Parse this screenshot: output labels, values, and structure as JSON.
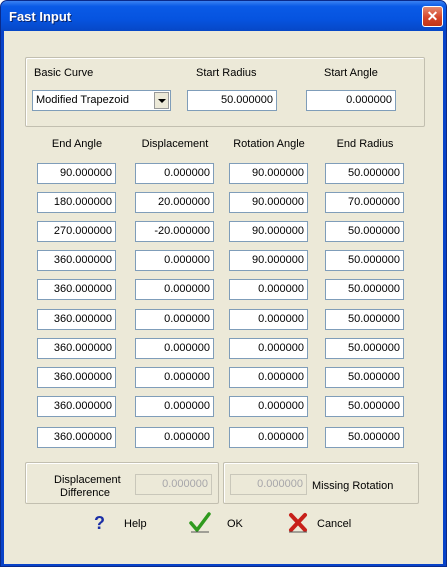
{
  "window": {
    "title": "Fast Input",
    "close_symbol": "✕"
  },
  "basic": {
    "basic_curve_label": "Basic Curve",
    "basic_curve_value": "Modified Trapezoid",
    "start_radius_label": "Start Radius",
    "start_radius_value": "50.000000",
    "start_angle_label": "Start Angle",
    "start_angle_value": "0.000000"
  },
  "table": {
    "headers": [
      "End Angle",
      "Displacement",
      "Rotation Angle",
      "End Radius"
    ],
    "rows": [
      [
        "90.000000",
        "0.000000",
        "90.000000",
        "50.000000"
      ],
      [
        "180.000000",
        "20.000000",
        "90.000000",
        "70.000000"
      ],
      [
        "270.000000",
        "-20.000000",
        "90.000000",
        "50.000000"
      ],
      [
        "360.000000",
        "0.000000",
        "90.000000",
        "50.000000"
      ],
      [
        "360.000000",
        "0.000000",
        "0.000000",
        "50.000000"
      ],
      [
        "360.000000",
        "0.000000",
        "0.000000",
        "50.000000"
      ],
      [
        "360.000000",
        "0.000000",
        "0.000000",
        "50.000000"
      ],
      [
        "360.000000",
        "0.000000",
        "0.000000",
        "50.000000"
      ],
      [
        "360.000000",
        "0.000000",
        "0.000000",
        "50.000000"
      ],
      [
        "360.000000",
        "0.000000",
        "0.000000",
        "50.000000"
      ]
    ]
  },
  "summary": {
    "displacement_diff_label_line1": "Displacement",
    "displacement_diff_label_line2": "Difference",
    "displacement_diff_value": "0.000000",
    "missing_rotation_value": "0.000000",
    "missing_rotation_label": "Missing Rotation"
  },
  "buttons": {
    "help": "Help",
    "ok": "OK",
    "cancel": "Cancel"
  },
  "icons": {
    "help": "question-mark-icon",
    "ok": "checkmark-icon",
    "cancel": "x-icon"
  },
  "colors": {
    "titlebar": "#0654e0",
    "dialog_bg": "#ece9d8",
    "help_icon": "#1b2fa6",
    "ok_icon": "#2f9a1e",
    "cancel_icon": "#c8201a"
  }
}
